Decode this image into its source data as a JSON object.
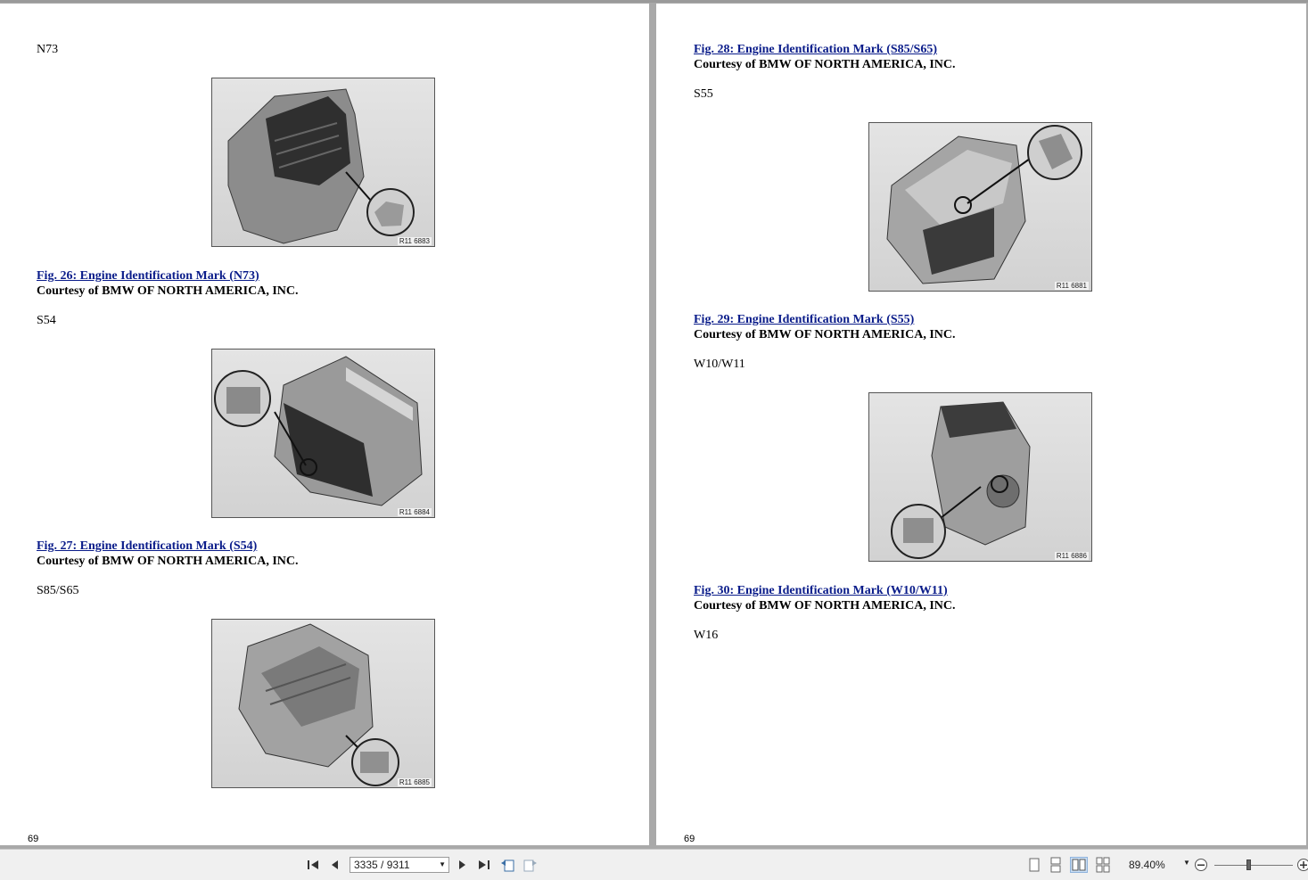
{
  "left_page": {
    "blocks": [
      {
        "label": "N73",
        "image_code": "R11 6883",
        "caption": "Fig. 26: Engine Identification Mark (N73)",
        "credit": "Courtesy of BMW OF NORTH AMERICA, INC."
      },
      {
        "label": "S54",
        "image_code": "R11 6884",
        "caption": "Fig. 27: Engine Identification Mark (S54)",
        "credit": "Courtesy of BMW OF NORTH AMERICA, INC."
      },
      {
        "label": "S85/S65",
        "image_code": "R11 6885"
      }
    ],
    "page_number": "69"
  },
  "right_page": {
    "top_caption": "Fig. 28: Engine Identification Mark (S85/S65)",
    "top_credit": "Courtesy of BMW OF NORTH AMERICA, INC.",
    "blocks": [
      {
        "label": "S55",
        "image_code": "R11 6881",
        "caption": "Fig. 29: Engine Identification Mark (S55)",
        "credit": "Courtesy of BMW OF NORTH AMERICA, INC."
      },
      {
        "label": "W10/W11",
        "image_code": "R11 6886",
        "caption": "Fig. 30: Engine Identification Mark (W10/W11)",
        "credit": "Courtesy of BMW OF NORTH AMERICA, INC."
      },
      {
        "label": "W16"
      }
    ],
    "page_number": "69"
  },
  "toolbar": {
    "page_indicator": "3335 / 9311",
    "zoom": "89.40%",
    "zoom_slider_fraction": 0.44,
    "icons": [
      "first-page-icon",
      "previous-page-icon",
      "next-page-icon",
      "last-page-icon",
      "previous-view-icon",
      "next-view-icon",
      "single-page-icon",
      "continuous-icon",
      "facing-icon",
      "continuous-facing-icon",
      "zoom-out-icon",
      "zoom-in-icon"
    ]
  },
  "colors": {
    "link": "#0a1c8a",
    "background": "#a9a9a9",
    "active_view": "#c9def5"
  }
}
